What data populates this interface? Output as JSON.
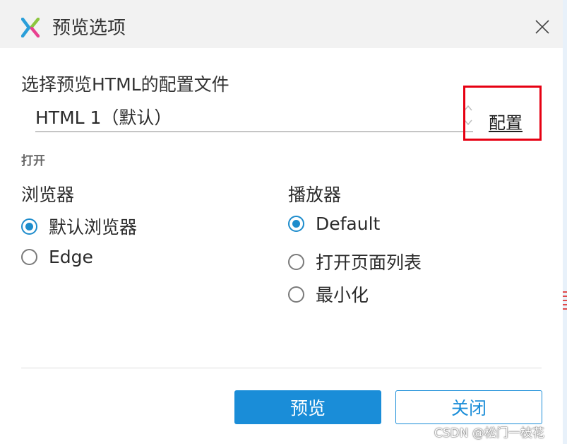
{
  "dialog": {
    "title": "预览选项",
    "close_icon": "close-icon",
    "logo_icon": "x-logo-icon",
    "logo_colors": [
      "#2b9fd9",
      "#8dc63f",
      "#e8408f"
    ]
  },
  "config_file": {
    "heading": "选择预览HTML的配置文件",
    "selected": "HTML 1（默认）",
    "config_link": "配置",
    "highlight_color": "#e60012"
  },
  "open_section": {
    "label": "打开",
    "browser": {
      "title": "浏览器",
      "options": [
        {
          "label": "默认浏览器",
          "checked": true
        },
        {
          "label": "Edge",
          "checked": false
        }
      ]
    },
    "player": {
      "title": "播放器",
      "options": [
        {
          "label": "Default",
          "checked": true
        },
        {
          "label": "打开页面列表",
          "checked": false
        },
        {
          "label": "最小化",
          "checked": false
        }
      ]
    }
  },
  "buttons": {
    "preview": "预览",
    "close": "关闭",
    "accent": "#1a8dd8"
  },
  "watermark": "CSDN @松门一枝花"
}
